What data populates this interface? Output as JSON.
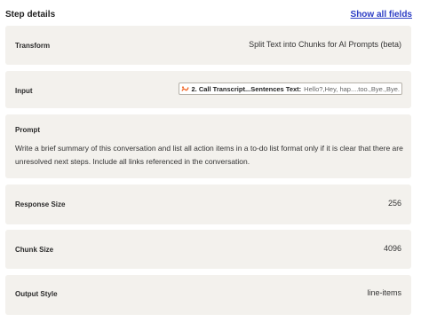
{
  "header": {
    "title": "Step details",
    "show_all_label": "Show all fields"
  },
  "fields": {
    "transform": {
      "label": "Transform",
      "value": "Split Text into Chunks for AI Prompts (beta)"
    },
    "input": {
      "label": "Input",
      "chip": {
        "icon": "transcript-app-icon",
        "step_label": "2. Call Transcript...Sentences Text:",
        "preview": "Hello?,Hey, hap....too.,Bye.,Bye."
      }
    },
    "prompt": {
      "label": "Prompt",
      "value": "Write a brief summary of this conversation and list all action items in a to-do list format only if it is clear that there are unresolved next steps. Include all links referenced in the conversation."
    },
    "response_size": {
      "label": "Response Size",
      "value": "256"
    },
    "chunk_size": {
      "label": "Chunk Size",
      "value": "4096"
    },
    "output_style": {
      "label": "Output Style",
      "value": "line-items"
    }
  },
  "colors": {
    "card_background": "#f3f1ed",
    "link": "#2d3ec5",
    "chip_icon": "#f26b2d"
  }
}
